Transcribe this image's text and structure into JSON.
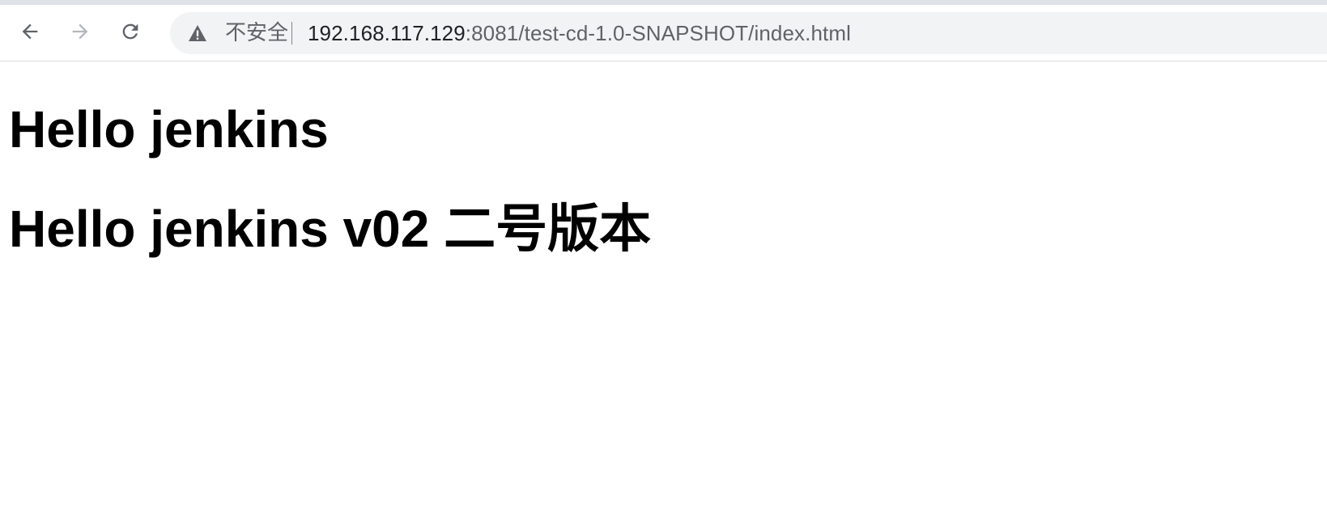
{
  "browser": {
    "security_label": "不安全",
    "url_host": "192.168.117.129",
    "url_rest": ":8081/test-cd-1.0-SNAPSHOT/index.html",
    "icons": {
      "back": "back-arrow-icon",
      "forward": "forward-arrow-icon",
      "reload": "reload-icon",
      "security": "warning-triangle-icon"
    },
    "colors": {
      "omnibox_bg": "#f1f3f4",
      "tab_strip": "#dee1e6",
      "text_primary": "#202124",
      "text_secondary": "#5f6368"
    }
  },
  "page": {
    "headings": [
      "Hello jenkins",
      "Hello jenkins v02 二号版本"
    ]
  }
}
